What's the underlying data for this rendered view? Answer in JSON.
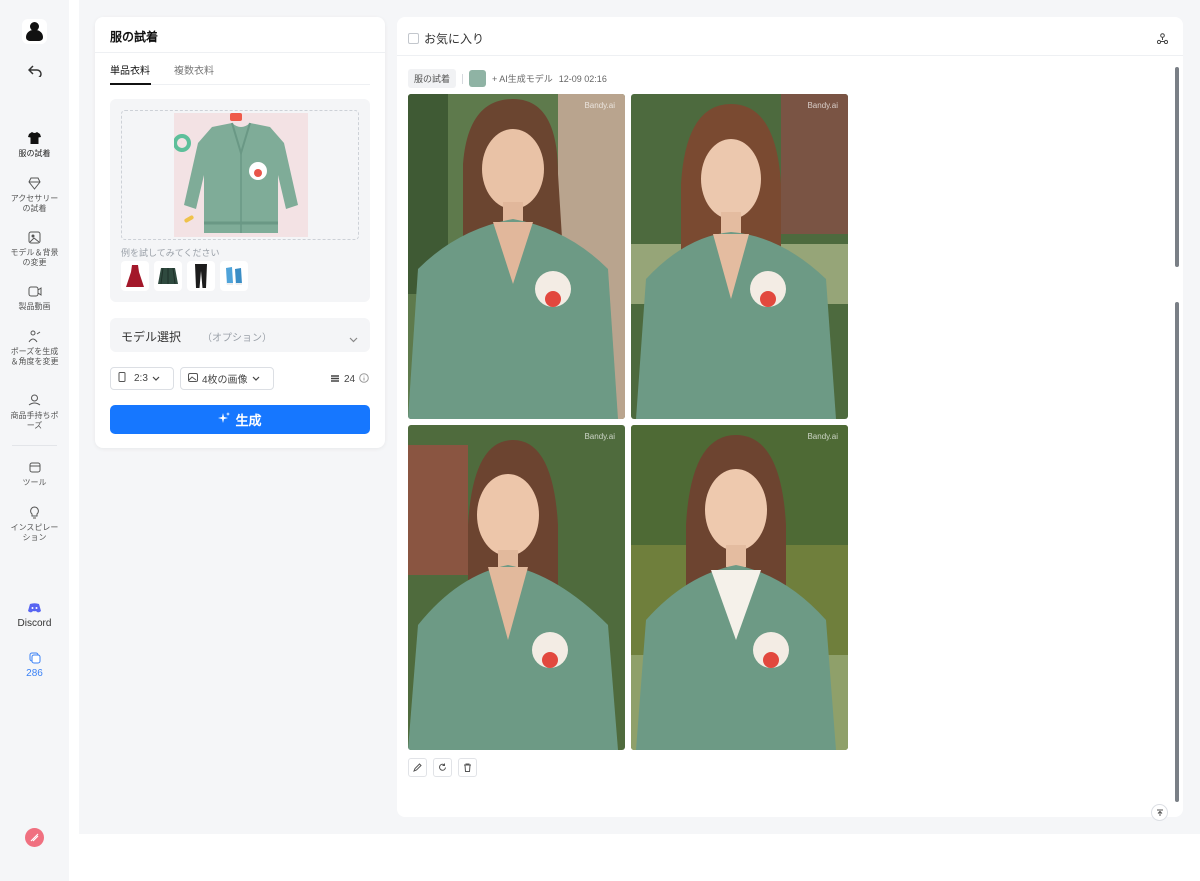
{
  "nav": {
    "items": [
      {
        "label": "服の試着",
        "icon": "shirt-icon",
        "active": true
      },
      {
        "label": "アクセサリーの試着",
        "icon": "gem-icon"
      },
      {
        "label": "モデル＆背景の変更",
        "icon": "image-swap-icon"
      },
      {
        "label": "製品動画",
        "icon": "video-icon"
      },
      {
        "label": "ポーズを生成＆角度を変更",
        "icon": "pose-icon"
      },
      {
        "label": "商品手持ちポーズ",
        "icon": "hand-hold-icon"
      },
      {
        "label": "ツール",
        "icon": "toolbox-icon"
      },
      {
        "label": "インスピレーション",
        "icon": "lightbulb-icon"
      }
    ],
    "discord": "Discord",
    "credits": "286"
  },
  "panel": {
    "title": "服の試着",
    "tabs": [
      "単品衣料",
      "複数衣料"
    ],
    "active_tab": 0,
    "example_label": "例を試してみてください",
    "example_thumbs": [
      "red-dress-icon",
      "plaid-skirt-icon",
      "black-pants-icon",
      "blue-sneakers-icon"
    ],
    "model_select": {
      "label": "モデル選択",
      "optional": "（オプション）"
    },
    "ratio": "2:3",
    "image_count": "4枚の画像",
    "cost": "24",
    "generate": "生成"
  },
  "results": {
    "favorites": "お気に入り",
    "tag": "服の試着",
    "model_label": "+ AI生成モデル",
    "timestamp": "12-09 02:16",
    "watermark": "Bandy.ai",
    "colors": {
      "accent": "#1677ff",
      "sweater": "#6d9a85",
      "credit": "#3b82f6"
    }
  }
}
